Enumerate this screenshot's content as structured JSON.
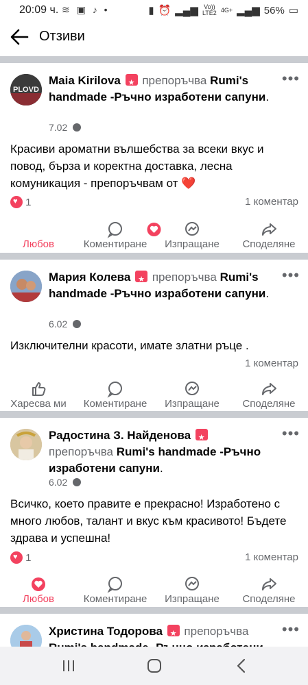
{
  "status": {
    "time": "20:09",
    "extra": "ч.",
    "battery": "56%",
    "net_top": "Vo))",
    "net_bottom": "LTE2",
    "gen": "4G+"
  },
  "header": {
    "title": "Отзиви"
  },
  "actions": {
    "love": "Любов",
    "like": "Харесва ми",
    "comment": "Коментиране",
    "send": "Изпращане",
    "share": "Споделяне"
  },
  "posts": [
    {
      "name": "Maia Kirilova",
      "rec": "препоръчва",
      "page": "Rumi's handmade -Ръчно изработени сапуни",
      "period": ".",
      "date": "7.02",
      "text": "Красиви ароматни вълшебства за всеки вкус и повод, бърза и коректна доставка, лесна комуникация - препоръчвам от ❤️",
      "reactions": "1",
      "comments": "1 коментар"
    },
    {
      "name": "Мария Колева",
      "rec": "препоръчва",
      "page": "Rumi's handmade -Ръчно изработени сапуни",
      "period": ".",
      "date": "6.02",
      "text": "Изключителни красоти, имате златни ръце .",
      "comments": "1 коментар"
    },
    {
      "name": "Радостина З. Найденова",
      "rec": "препоръчва",
      "page": "Rumi's handmade -Ръчно изработени сапуни",
      "period": ".",
      "date": "6.02",
      "text": "Всичко, което правите е прекрасно! Изработено с много любов, талант и вкус към красивото! Бъдете здрава и успешна!",
      "reactions": "1",
      "comments": "1 коментар"
    },
    {
      "name": "Христина Тодорова",
      "rec": "препоръчва",
      "page": "Rumi's handmade -Ръчно изработени"
    }
  ]
}
